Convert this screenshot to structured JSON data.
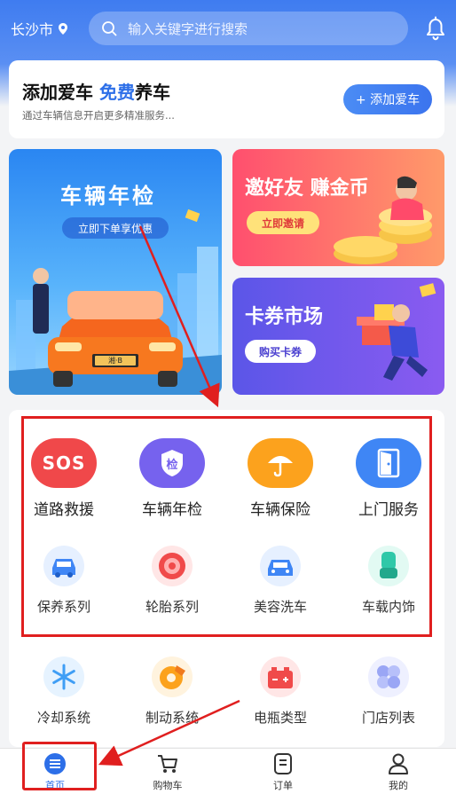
{
  "header": {
    "city": "长沙市",
    "search_placeholder": "输入关键字进行搜索"
  },
  "add_car": {
    "title_part1": "添加爱车",
    "title_highlight": "免费",
    "title_part2": "养车",
    "subtitle": "通过车辆信息开启更多精准服务...",
    "button_label": "+ 添加爱车"
  },
  "banners": {
    "inspection": {
      "title": "车辆年检",
      "pill": "立即下单享优惠",
      "plate": "湘·B"
    },
    "invite": {
      "title": "邀好友 赚金币",
      "pill": "立即邀请"
    },
    "coupon": {
      "title": "卡券市场",
      "pill": "购买卡券"
    }
  },
  "primary_services": [
    {
      "label": "道路救援",
      "icon_text": "SOS",
      "icon": "sos-icon",
      "color": "#f0484a"
    },
    {
      "label": "车辆年检",
      "icon_text": "检",
      "icon": "inspection-shield-icon",
      "color": "#7662ee"
    },
    {
      "label": "车辆保险",
      "icon_text": "",
      "icon": "umbrella-icon",
      "color": "#fca21d"
    },
    {
      "label": "上门服务",
      "icon_text": "",
      "icon": "door-icon",
      "color": "#3f86f5"
    }
  ],
  "secondary_services": [
    {
      "label": "保养系列",
      "icon": "car-repair-icon",
      "color": "#3f86f5"
    },
    {
      "label": "轮胎系列",
      "icon": "tire-icon",
      "color": "#f04a4a"
    },
    {
      "label": "美容洗车",
      "icon": "car-wash-icon",
      "color": "#3f86f5"
    },
    {
      "label": "车载内饰",
      "icon": "car-seat-icon",
      "color": "#2fc8a8"
    }
  ],
  "more_services": [
    {
      "label": "冷却系统",
      "icon": "snowflake-icon",
      "color": "#3f9ef5"
    },
    {
      "label": "制动系统",
      "icon": "brake-icon",
      "color": "#fca21d"
    },
    {
      "label": "电瓶类型",
      "icon": "battery-icon",
      "color": "#f04a4a"
    },
    {
      "label": "门店列表",
      "icon": "grid-icon",
      "color": "#9aa6f5"
    }
  ],
  "tabbar": {
    "home": "首页",
    "cart": "购物车",
    "orders": "订单",
    "mine": "我的"
  },
  "colors": {
    "primary": "#3f7cf0",
    "highlight_box": "#e01f1f"
  }
}
